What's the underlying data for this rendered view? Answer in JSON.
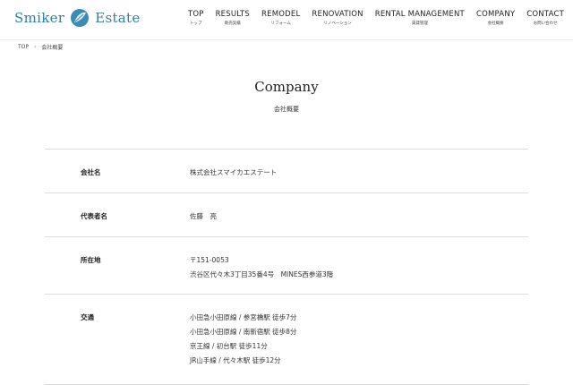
{
  "header": {
    "logo": {
      "left": "Smiker",
      "right": "Estate",
      "mark": "leaf-logo-icon"
    },
    "nav": [
      {
        "en": "TOP",
        "ja": "トップ"
      },
      {
        "en": "RESULTS",
        "ja": "販売実績"
      },
      {
        "en": "REMODEL",
        "ja": "リフォーム"
      },
      {
        "en": "RENOVATION",
        "ja": "リノベーション"
      },
      {
        "en": "RENTAL MANAGEMENT",
        "ja": "賃貸管理"
      },
      {
        "en": "COMPANY",
        "ja": "会社概要"
      },
      {
        "en": "CONTACT",
        "ja": "お問い合わせ"
      }
    ]
  },
  "breadcrumb": {
    "home": "TOP",
    "separator": "›",
    "current": "会社概要"
  },
  "page": {
    "title": "Company",
    "subtitle": "会社概要"
  },
  "company_table": [
    {
      "label": "会社名",
      "values": [
        "株式会社スマイカエステート"
      ]
    },
    {
      "label": "代表者名",
      "values": [
        "佐藤　亮"
      ]
    },
    {
      "label": "所在地",
      "values": [
        "〒151-0053",
        "渋谷区代々木3丁目35番4号　MINES西参道3階"
      ]
    },
    {
      "label": "交通",
      "values": [
        "小田急小田原線 / 参宮橋駅 徒歩7分",
        "小田急小田原線 / 南新宿駅 徒歩8分",
        "京王線 / 初台駅 徒歩11分",
        "JR山手線 / 代々木駅 徒歩12分"
      ]
    }
  ],
  "colors": {
    "brand": "#2f7fa8",
    "divider": "#dddddd"
  }
}
